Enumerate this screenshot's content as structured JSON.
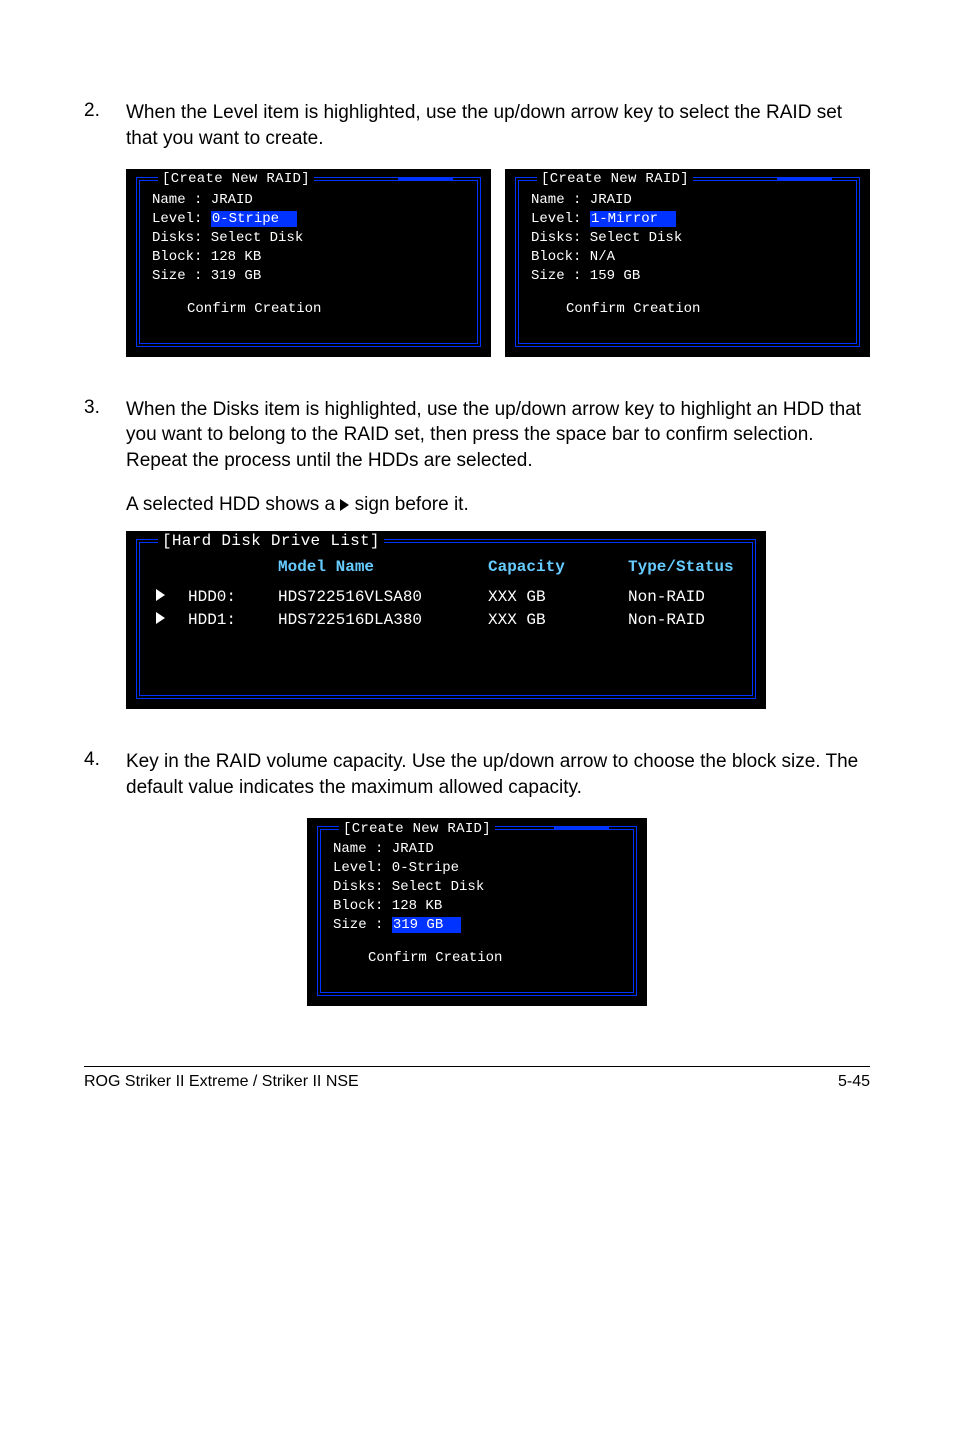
{
  "step2": {
    "num": "2.",
    "text": "When the Level item is highlighted, use the up/down arrow key to select the RAID set that you want to create."
  },
  "panelA": {
    "title": "[Create New RAID]",
    "name_row": "Name : JRAID",
    "level_label": "Level: ",
    "level_value": "0-Stripe  ",
    "disks_row": "Disks: Select Disk",
    "block_row": "Block: 128 KB",
    "size_row": "Size : 319 GB",
    "confirm": "Confirm Creation"
  },
  "panelB": {
    "title": "[Create New RAID]",
    "name_row": "Name : JRAID",
    "level_label": "Level: ",
    "level_value": "1-Mirror  ",
    "disks_row": "Disks: Select Disk",
    "block_row": "Block: N/A",
    "size_row": "Size : 159 GB",
    "confirm": "Confirm Creation"
  },
  "step3": {
    "num": "3.",
    "text": "When the Disks item is highlighted, use the up/down arrow key to highlight an HDD that you want to belong to the RAID set, then press the space bar to confirm selection. Repeat the process until the HDDs are selected.",
    "sub_pre": "A selected HDD shows a ",
    "sub_post": " sign before it."
  },
  "disklist": {
    "title": "[Hard Disk Drive List]",
    "hdr": {
      "model": "Model Name",
      "capacity": "Capacity",
      "type": "Type/Status"
    },
    "row0": {
      "id": "HDD0:",
      "model": "HDS722516VLSA80",
      "cap": "XXX GB",
      "type": "Non-RAID"
    },
    "row1": {
      "id": "HDD1:",
      "model": "HDS722516DLA380",
      "cap": "XXX GB",
      "type": "Non-RAID"
    }
  },
  "step4": {
    "num": "4.",
    "text": "Key in the RAID volume capacity. Use the up/down arrow to choose the block size. The default value indicates the maximum allowed capacity."
  },
  "panelC": {
    "title": "[Create New RAID]",
    "name_row": "Name : JRAID",
    "level_row": "Level: 0-Stripe",
    "disks_row": "Disks: Select Disk",
    "block_row": "Block: 128 KB",
    "size_label": "Size : ",
    "size_value": "319 GB  ",
    "confirm": "Confirm Creation"
  },
  "footer": {
    "left": "ROG Striker II Extreme / Striker II NSE",
    "right": "5-45"
  }
}
